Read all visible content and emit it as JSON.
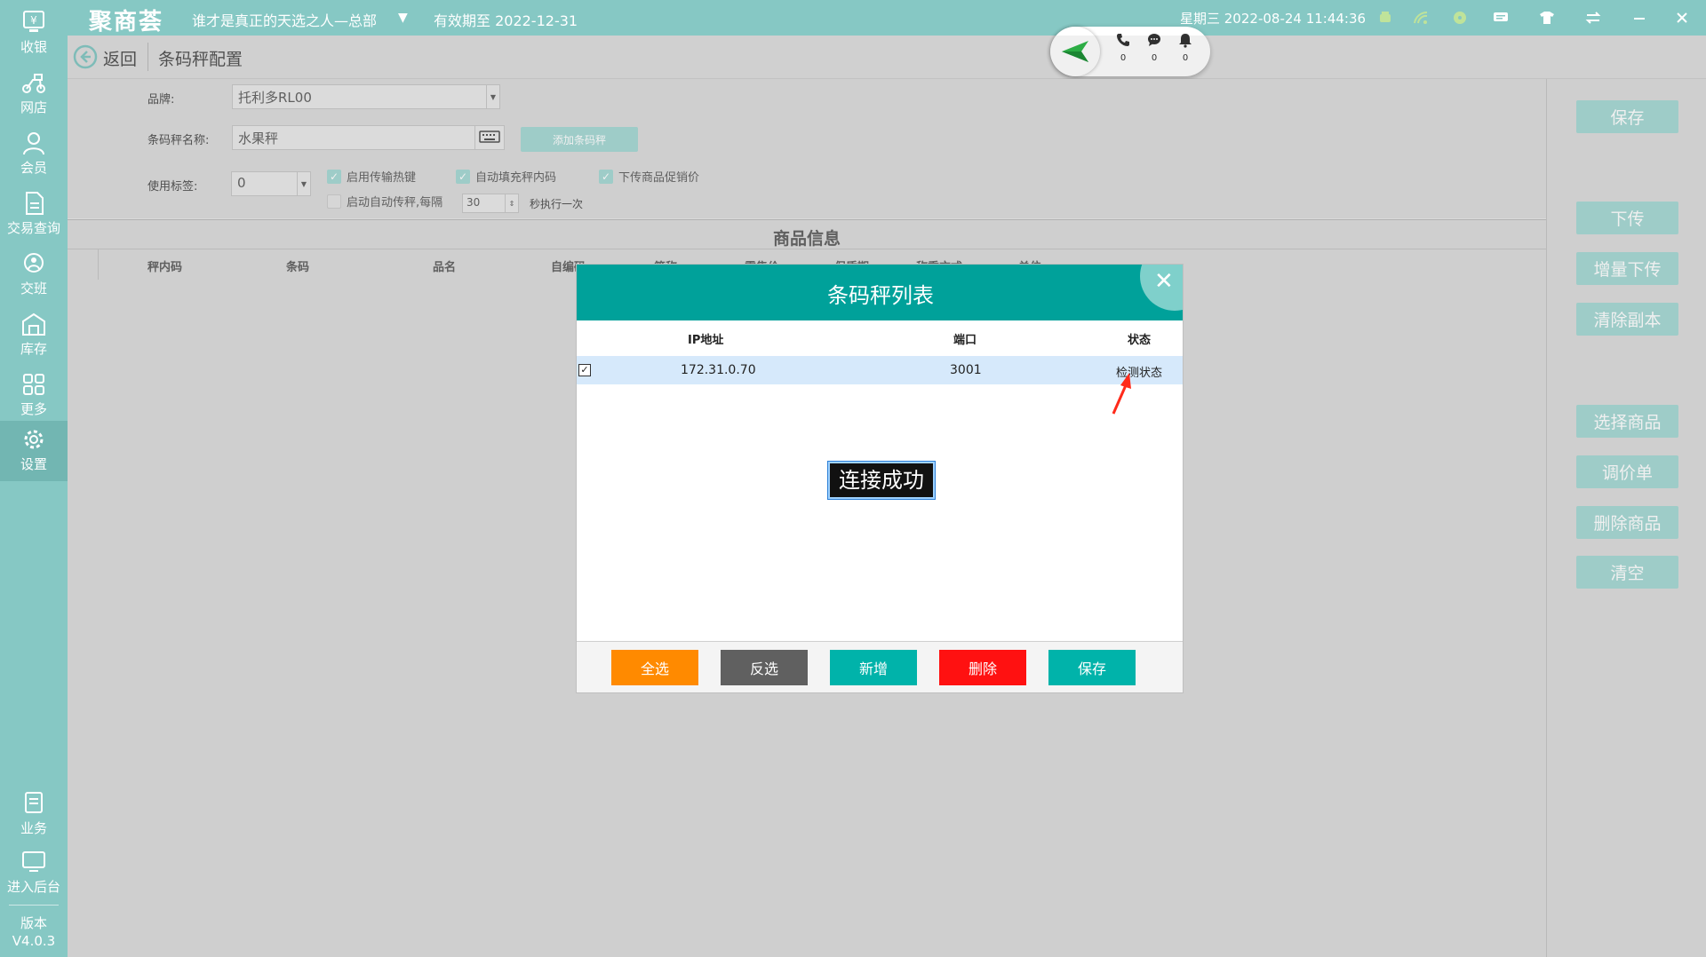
{
  "topbar": {
    "logo": "聚商荟",
    "store": "谁才是真正的天选之人—总部",
    "expire": "有效期至 2022-12-31",
    "datetime": "星期三 2022-08-24 11:44:36",
    "icons": [
      "printer-icon",
      "wifi-icon",
      "drive-icon",
      "message-icon",
      "shirt-icon",
      "switch-icon",
      "minimize-icon",
      "maximize-icon",
      "close-icon"
    ]
  },
  "sidebar": {
    "items": [
      {
        "label": "收银",
        "icon": "cashier-icon"
      },
      {
        "label": "网店",
        "icon": "scooter-icon"
      },
      {
        "label": "会员",
        "icon": "member-icon"
      },
      {
        "label": "交易查询",
        "icon": "document-icon"
      },
      {
        "label": "交班",
        "icon": "handover-icon"
      },
      {
        "label": "库存",
        "icon": "warehouse-icon"
      },
      {
        "label": "更多",
        "icon": "grid-icon"
      },
      {
        "label": "设置",
        "icon": "gear-icon"
      }
    ],
    "bottom": [
      {
        "label": "业务",
        "icon": "business-icon"
      },
      {
        "label": "进入后台",
        "icon": "monitor-icon"
      }
    ],
    "version_label": "版本",
    "version": "V4.0.3"
  },
  "header": {
    "back": "返回",
    "title": "条码秤配置"
  },
  "comm": {
    "phone_count": "0",
    "chat_count": "0",
    "bell_count": "0"
  },
  "form": {
    "brand_label": "品牌:",
    "brand_value": "托利多RL00",
    "name_label": "条码秤名称:",
    "name_value": "水果秤",
    "add_scale": "添加条码秤",
    "tag_label": "使用标签:",
    "tag_value": "0",
    "chk_hotkey": "启用传输热键",
    "chk_autofill": "自动填充秤内码",
    "chk_promo": "下传商品促销价",
    "chk_auto": "启动自动传秤,每隔",
    "interval": "30",
    "interval_suffix": "秒执行一次"
  },
  "product": {
    "title": "商品信息",
    "columns": [
      "秤内码",
      "条码",
      "品名",
      "自编码",
      "简称",
      "零售价",
      "保质期",
      "称重方式",
      "单位"
    ]
  },
  "right": {
    "buttons": [
      "保存",
      "下传",
      "增量下传",
      "清除副本",
      "选择商品",
      "调价单",
      "删除商品",
      "清空"
    ]
  },
  "dialog": {
    "title": "条码秤列表",
    "col_ip": "IP地址",
    "col_port": "端口",
    "col_status": "状态",
    "rows": [
      {
        "ip": "172.31.0.70",
        "port": "3001",
        "status": "检测状态"
      }
    ],
    "toast": "连接成功",
    "footer": [
      {
        "label": "全选",
        "color": "#ff8a00"
      },
      {
        "label": "反选",
        "color": "#606060"
      },
      {
        "label": "新增",
        "color": "#00b3aa"
      },
      {
        "label": "删除",
        "color": "#ff1111"
      },
      {
        "label": "保存",
        "color": "#00b3aa"
      }
    ]
  }
}
